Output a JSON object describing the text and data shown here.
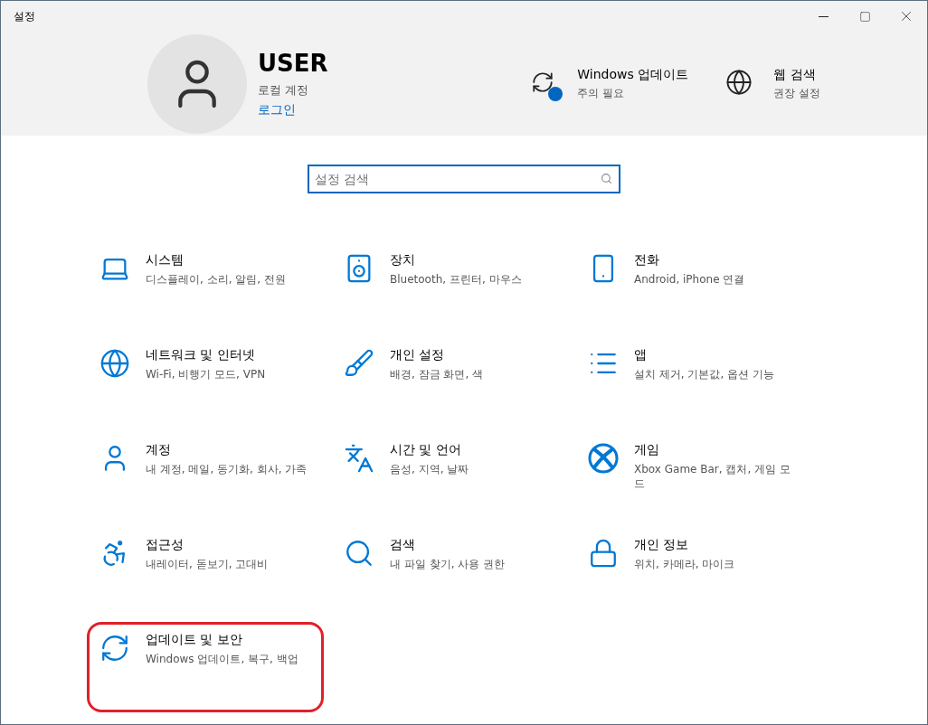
{
  "window": {
    "title": "설정"
  },
  "account": {
    "name": "USER",
    "type": "로컬 계정",
    "link": "로그인"
  },
  "header_links": [
    {
      "kind": "update",
      "title": "Windows 업데이트",
      "subtitle": "주의 필요",
      "alert": true
    },
    {
      "kind": "web",
      "title": "웹 검색",
      "subtitle": "권장 설정",
      "alert": false
    }
  ],
  "search": {
    "placeholder": "설정 검색"
  },
  "tiles": [
    {
      "title": "시스템",
      "subtitle": "디스플레이, 소리, 알림, 전원",
      "highlighted": false
    },
    {
      "title": "장치",
      "subtitle": "Bluetooth, 프린터, 마우스",
      "highlighted": false
    },
    {
      "title": "전화",
      "subtitle": "Android, iPhone 연결",
      "highlighted": false
    },
    {
      "title": "네트워크 및 인터넷",
      "subtitle": "Wi-Fi, 비행기 모드, VPN",
      "highlighted": false
    },
    {
      "title": "개인 설정",
      "subtitle": "배경, 잠금 화면, 색",
      "highlighted": false
    },
    {
      "title": "앱",
      "subtitle": "설치 제거, 기본값, 옵션 기능",
      "highlighted": false
    },
    {
      "title": "계정",
      "subtitle": "내 계정, 메일, 동기화, 회사, 가족",
      "highlighted": false
    },
    {
      "title": "시간 및 언어",
      "subtitle": "음성, 지역, 날짜",
      "highlighted": false
    },
    {
      "title": "게임",
      "subtitle": "Xbox Game Bar, 캡처, 게임 모드",
      "highlighted": false
    },
    {
      "title": "접근성",
      "subtitle": "내레이터, 돋보기, 고대비",
      "highlighted": false
    },
    {
      "title": "검색",
      "subtitle": "내 파일 찾기, 사용 권한",
      "highlighted": false
    },
    {
      "title": "개인 정보",
      "subtitle": "위치, 카메라, 마이크",
      "highlighted": false
    },
    {
      "title": "업데이트 및 보안",
      "subtitle": "Windows 업데이트, 복구, 백업",
      "highlighted": true
    }
  ]
}
